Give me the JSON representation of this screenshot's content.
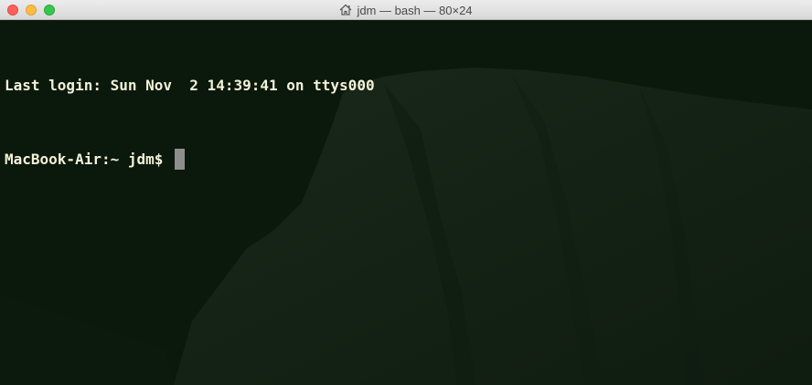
{
  "window": {
    "title": "jdm — bash — 80×24",
    "title_icon": "home-icon"
  },
  "terminal": {
    "lines": [
      "Last login: Sun Nov  2 14:39:41 on ttys000",
      "MacBook-Air:~ jdm$ "
    ],
    "text_color": "#f2f2d8",
    "background_color": "#0b180c",
    "cursor_color": "#8e8e8e"
  },
  "traffic_lights": {
    "close_color": "#fc605c",
    "minimize_color": "#fdbc40",
    "zoom_color": "#34c84a"
  }
}
